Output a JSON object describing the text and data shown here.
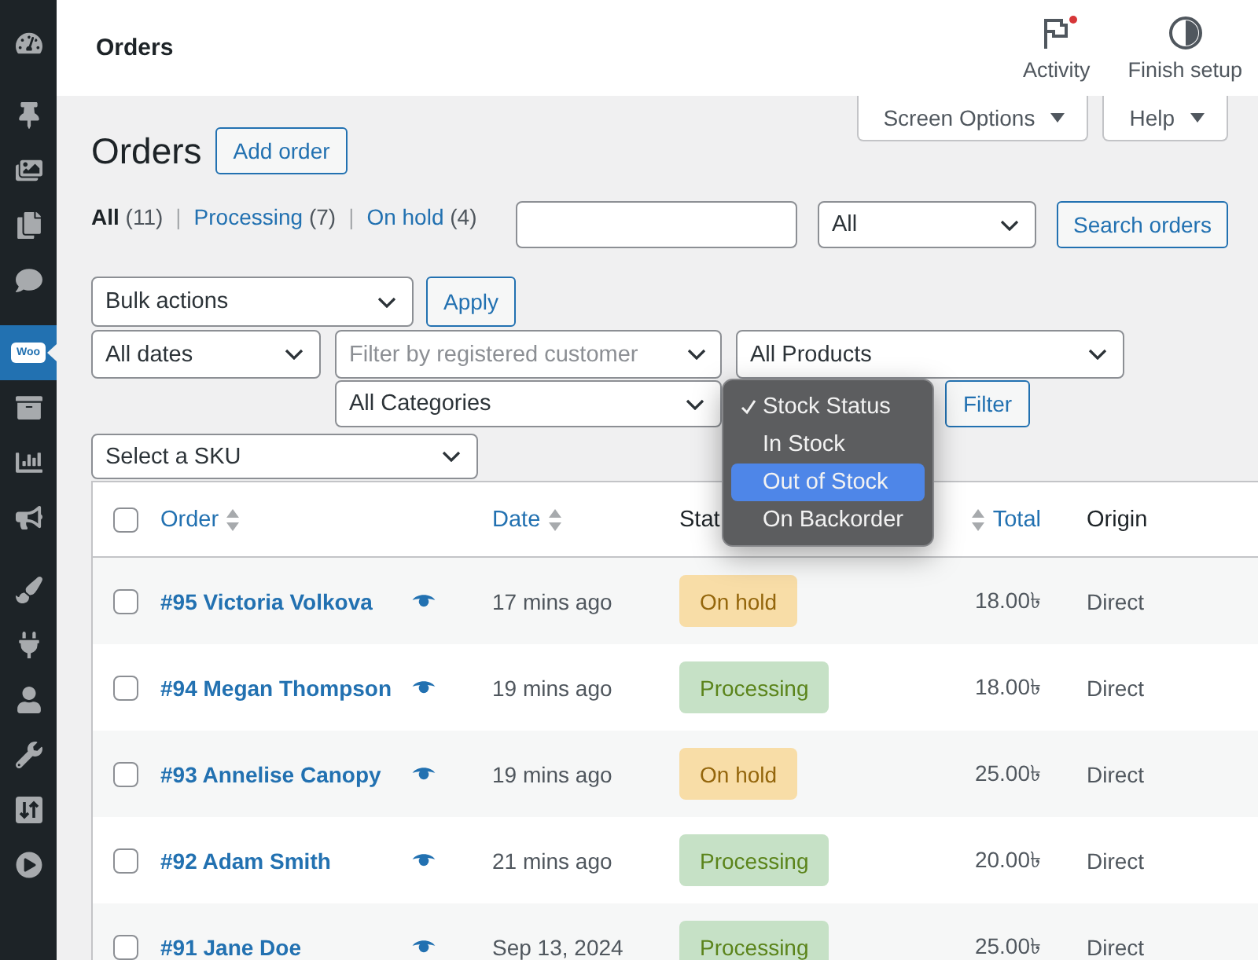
{
  "sidebar": {
    "groups": [
      [
        {
          "kind": "dashboard",
          "selected": false
        }
      ],
      [
        {
          "kind": "pin",
          "selected": false
        },
        {
          "kind": "media",
          "selected": false
        },
        {
          "kind": "pages",
          "selected": false
        },
        {
          "kind": "comments",
          "selected": false
        }
      ],
      [
        {
          "kind": "woo",
          "text": "Woo",
          "selected": true
        },
        {
          "kind": "products",
          "selected": false
        },
        {
          "kind": "analytics",
          "selected": false
        },
        {
          "kind": "marketing",
          "selected": false
        }
      ],
      [
        {
          "kind": "appearance",
          "selected": false
        },
        {
          "kind": "plugins",
          "selected": false
        },
        {
          "kind": "users",
          "selected": false
        },
        {
          "kind": "tools",
          "selected": false
        },
        {
          "kind": "settings",
          "selected": false
        },
        {
          "kind": "play",
          "selected": false
        }
      ]
    ]
  },
  "header": {
    "title": "Orders",
    "actions": [
      {
        "kind": "activity",
        "label": "Activity",
        "notification": true
      },
      {
        "kind": "setup",
        "label": "Finish setup",
        "notification": false
      }
    ]
  },
  "screen_tabs": [
    {
      "label": "Screen Options"
    },
    {
      "label": "Help"
    }
  ],
  "page": {
    "title": "Orders",
    "add_button": "Add order"
  },
  "views": {
    "separator": "|",
    "items": [
      {
        "label": "All",
        "count": "(11)",
        "selected": true
      },
      {
        "label": "Processing",
        "count": "(7)",
        "selected": false
      },
      {
        "label": "On hold",
        "count": "(4)",
        "selected": false
      }
    ]
  },
  "search": {
    "type_select": "All",
    "button": "Search orders"
  },
  "bulk": {
    "select": "Bulk actions",
    "button": "Apply"
  },
  "filters": {
    "dates": "All dates",
    "customer": {
      "placeholder": "Filter by registered customer"
    },
    "products": "All Products",
    "categories": "All Categories",
    "stock_menu": {
      "options": [
        {
          "label": "Stock Status",
          "selected": true,
          "highlighted": false
        },
        {
          "label": "In Stock",
          "selected": false,
          "highlighted": false
        },
        {
          "label": "Out of Stock",
          "selected": false,
          "highlighted": true
        },
        {
          "label": "On Backorder",
          "selected": false,
          "highlighted": false
        }
      ]
    },
    "button": "Filter",
    "sku": "Select a SKU"
  },
  "table": {
    "all_checked": false,
    "columns": [
      {
        "label": "Order",
        "sortable": true
      },
      {
        "label": "Date",
        "sortable": true
      },
      {
        "label": "Stat",
        "sortable": false
      },
      {
        "label": "Total",
        "sortable": true
      },
      {
        "label": "Origin",
        "sortable": false
      }
    ],
    "rows": [
      {
        "checked": false,
        "order": "#95 Victoria Volkova",
        "date": "17 mins ago",
        "status": {
          "label": "On hold",
          "kind": "on-hold"
        },
        "total": "18.00৳",
        "origin": "Direct"
      },
      {
        "checked": false,
        "order": "#94 Megan Thompson",
        "date": "19 mins ago",
        "status": {
          "label": "Processing",
          "kind": "processing"
        },
        "total": "18.00৳",
        "origin": "Direct"
      },
      {
        "checked": false,
        "order": "#93 Annelise Canopy",
        "date": "19 mins ago",
        "status": {
          "label": "On hold",
          "kind": "on-hold"
        },
        "total": "25.00৳",
        "origin": "Direct"
      },
      {
        "checked": false,
        "order": "#92 Adam Smith",
        "date": "21 mins ago",
        "status": {
          "label": "Processing",
          "kind": "processing"
        },
        "total": "20.00৳",
        "origin": "Direct"
      },
      {
        "checked": false,
        "order": "#91 Jane Doe",
        "date": "Sep 13, 2024",
        "status": {
          "label": "Processing",
          "kind": "processing"
        },
        "total": "25.00৳",
        "origin": "Direct"
      }
    ]
  }
}
